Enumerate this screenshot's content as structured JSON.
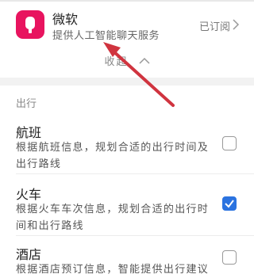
{
  "service": {
    "name": "微软",
    "description": "提供人工智能聊天服务",
    "subscription_status": "已订阅",
    "icon": "microsoft-app-icon",
    "icon_color": "#e8145f"
  },
  "collapse_label": "收起",
  "section_title": "出行",
  "items": [
    {
      "title": "航班",
      "description": "根据航班信息，规划合适的出行时间及出行路线",
      "checked": false
    },
    {
      "title": "火车",
      "description": "根据火车车次信息，规划合适的出行时间和出行路线",
      "checked": true
    },
    {
      "title": "酒店",
      "description": "根据酒店预订信息，智能提供出行建议",
      "checked": false
    }
  ],
  "colors": {
    "checkbox_checked": "#2b73e0",
    "annotation_arrow": "#d0343f"
  }
}
